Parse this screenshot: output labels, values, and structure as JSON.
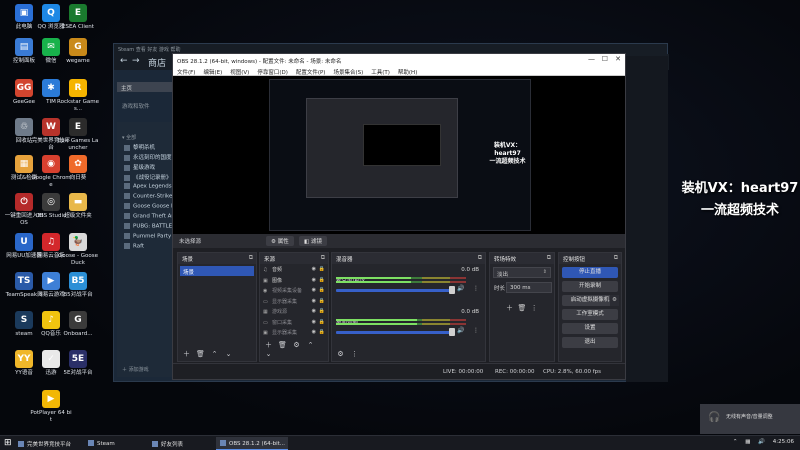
{
  "desktop": {
    "icons": [
      {
        "label": "此电脑",
        "color": "#2a6fd6",
        "glyph": "▣"
      },
      {
        "label": "QQ 浏览器",
        "color": "#1e88e5",
        "glyph": "Q"
      },
      {
        "label": "ESEA Client",
        "color": "#1a7a2e",
        "glyph": "E"
      },
      {
        "label": "控制面板",
        "color": "#3a7bd5",
        "glyph": "▤"
      },
      {
        "label": "微信",
        "color": "#18b24b",
        "glyph": "✉"
      },
      {
        "label": "wegame",
        "color": "#c98a1a",
        "glyph": "G"
      },
      {
        "label": "GeeGee",
        "color": "#d2452f",
        "glyph": "GG"
      },
      {
        "label": "TIM",
        "color": "#2b7bd8",
        "glyph": "✱"
      },
      {
        "label": "Rockstar Games...",
        "color": "#f5b400",
        "glyph": "R"
      },
      {
        "label": "回收站",
        "color": "#6f7b8a",
        "glyph": "♲"
      },
      {
        "label": "完美世界竞技平台",
        "color": "#b7332b",
        "glyph": "W"
      },
      {
        "label": "Epic Games Launcher",
        "color": "#2b2b2b",
        "glyph": "E"
      },
      {
        "label": "测试&检测",
        "color": "#e6a23c",
        "glyph": "▦"
      },
      {
        "label": "Google Chrome",
        "color": "#d7402f",
        "glyph": "◉"
      },
      {
        "label": "向日葵",
        "color": "#ef6a2a",
        "glyph": "✿"
      },
      {
        "label": "一键重回进入BIOS",
        "color": "#b52a2a",
        "glyph": "⏻"
      },
      {
        "label": "OBS Studio",
        "color": "#3b3b3b",
        "glyph": "◎"
      },
      {
        "label": "超级文件夹",
        "color": "#e8b84a",
        "glyph": "▬"
      },
      {
        "label": "网易UU加速器",
        "color": "#2a67c9",
        "glyph": "U"
      },
      {
        "label": "网易云音乐",
        "color": "#d3272b",
        "glyph": "♫"
      },
      {
        "label": "Goose - Goose Duck",
        "color": "#d9d9d9",
        "glyph": "🦆"
      },
      {
        "label": "TeamSpeak 3",
        "color": "#2a5aa8",
        "glyph": "TS"
      },
      {
        "label": "网易云游戏",
        "color": "#3d7fd6",
        "glyph": "▶"
      },
      {
        "label": "B5对战平台",
        "color": "#2b8fd6",
        "glyph": "B5"
      },
      {
        "label": "steam",
        "color": "#1b3a5c",
        "glyph": "S"
      },
      {
        "label": "QQ音乐",
        "color": "#f1c40f",
        "glyph": "♪"
      },
      {
        "label": "Onboard...",
        "color": "#3b3b3b",
        "glyph": "G"
      },
      {
        "label": "YY语音",
        "color": "#f0b72a",
        "glyph": "YY"
      },
      {
        "label": "迅游",
        "color": "#e9e9e9",
        "glyph": "✓"
      },
      {
        "label": "5E对战平台",
        "color": "#2a2f68",
        "glyph": "5E"
      },
      {
        "label": "PotPlayer 64 bit",
        "color": "#f2b705",
        "glyph": "▶"
      }
    ]
  },
  "steam": {
    "top": "Steam  查看  好友  游戏  帮助",
    "nav_store": "商店",
    "home": "主页",
    "library_label": "游戏和软件",
    "all_label": "全部",
    "games": [
      "黎明杀机",
      "永远刻印的国度",
      "星级游戏",
      "《战役记录册》",
      "Apex Legends",
      "Counter-Strike",
      "Goose Goose Duck",
      "Grand Theft Auto",
      "PUBG: BATTLEGROUNDS",
      "Pummel Party",
      "Raft"
    ],
    "add_game": "添加游戏",
    "right_text": "台"
  },
  "obs": {
    "title": "OBS 28.1.2 (64-bit, windows) - 配置文件: 未命名 - 场景: 未命名",
    "menu": [
      "文件(F)",
      "编辑(E)",
      "视图(V)",
      "停靠窗口(D)",
      "配置文件(P)",
      "场景集合(S)",
      "工具(T)",
      "帮助(H)"
    ],
    "preview_overlay": "装机VX: heart97\n一流超频技术",
    "no_source": "未选择源",
    "props_label": "属性",
    "filters_label": "滤镜",
    "scenes": {
      "title": "场景",
      "items": [
        "场景"
      ]
    },
    "sources": {
      "title": "来源",
      "items": [
        {
          "icon": "♫",
          "label": "音频"
        },
        {
          "icon": "▣",
          "label": "图像"
        },
        {
          "icon": "◉",
          "label": "视频采集设备"
        },
        {
          "icon": "▭",
          "label": "显示器采集"
        },
        {
          "icon": "▦",
          "label": "游戏源"
        },
        {
          "icon": "▭",
          "label": "窗口采集"
        },
        {
          "icon": "▣",
          "label": "显示器采集"
        }
      ]
    },
    "mixer": {
      "title": "混音器",
      "channels": [
        {
          "name": "麦克风/Aux",
          "db": "0.0 dB",
          "level": 0.58
        },
        {
          "name": "桌面音频",
          "db": "0.0 dB",
          "level": 0.62
        }
      ]
    },
    "transitions": {
      "title": "转场特效",
      "selected": "淡出",
      "duration_label": "时长",
      "duration_value": "300 ms"
    },
    "controls": {
      "title": "控制按钮",
      "buttons": [
        "停止直播",
        "开始录制",
        "启动虚拟摄像机",
        "工作室模式",
        "设置",
        "退出"
      ]
    },
    "status": {
      "live": "LIVE: 00:00:00",
      "rec": "REC: 00:00:00",
      "cpu": "CPU: 2.8%, 60.00 fps"
    }
  },
  "overlay": {
    "line1": "装机VX：heart97",
    "line2": "一流超频技术"
  },
  "notification": {
    "text": "无线有声音/音量调整"
  },
  "taskbar": {
    "apps": [
      {
        "label": "完美世界竞技平台",
        "active": false
      },
      {
        "label": "Steam",
        "active": false
      },
      {
        "label": "好友列表",
        "active": false
      },
      {
        "label": "OBS 28.1.2 (64-bit...",
        "active": true
      }
    ],
    "time": "4:25:06"
  },
  "colors": {
    "accent": "#2f57b5",
    "obs_bg": "#1e1f24",
    "steam_bg": "#1b2838"
  }
}
